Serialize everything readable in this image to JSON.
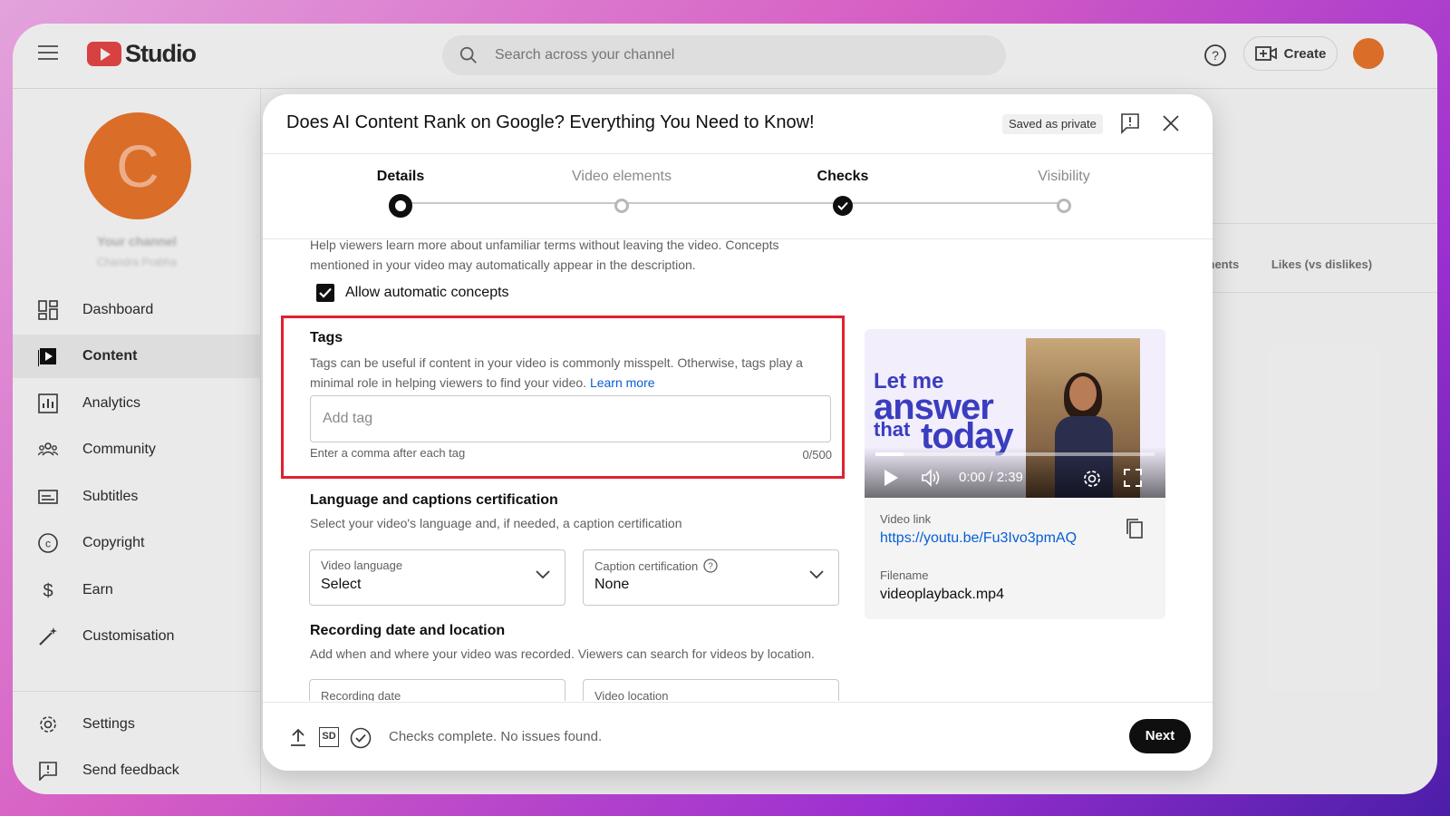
{
  "app": {
    "logo_text": "Studio",
    "search_placeholder": "Search across your channel",
    "create_label": "Create"
  },
  "sidebar": {
    "avatar_letter": "C",
    "channel_name": "Your channel",
    "channel_handle": "Chandra Prabha",
    "items": [
      {
        "label": "Dashboard",
        "icon": "dashboard-icon"
      },
      {
        "label": "Content",
        "icon": "content-icon"
      },
      {
        "label": "Analytics",
        "icon": "analytics-icon"
      },
      {
        "label": "Community",
        "icon": "community-icon"
      },
      {
        "label": "Subtitles",
        "icon": "subtitles-icon"
      },
      {
        "label": "Copyright",
        "icon": "copyright-icon"
      },
      {
        "label": "Earn",
        "icon": "earn-icon"
      },
      {
        "label": "Customisation",
        "icon": "customisation-icon"
      },
      {
        "label": "Settings",
        "icon": "settings-icon"
      },
      {
        "label": "Send feedback",
        "icon": "feedback-icon"
      }
    ],
    "active_item": "Content"
  },
  "background": {
    "col_comments": "Comments",
    "col_likes": "Likes (vs dislikes)"
  },
  "modal": {
    "title": "Does AI Content Rank on Google? Everything You Need to Know!",
    "saved_badge": "Saved as private",
    "steps": [
      {
        "label": "Details",
        "state": "current"
      },
      {
        "label": "Video elements",
        "state": "empty"
      },
      {
        "label": "Checks",
        "state": "done"
      },
      {
        "label": "Visibility",
        "state": "empty"
      }
    ],
    "concepts": {
      "description": "Help viewers learn more about unfamiliar terms without leaving the video. Concepts mentioned in your video may automatically appear in the description.",
      "checkbox_label": "Allow automatic concepts",
      "checked": true
    },
    "tags": {
      "title": "Tags",
      "description": "Tags can be useful if content in your video is commonly misspelt. Otherwise, tags play a minimal role in helping viewers to find your video.",
      "learn_more": "Learn more",
      "placeholder": "Add tag",
      "hint": "Enter a comma after each tag",
      "count": "0/500"
    },
    "language": {
      "title": "Language and captions certification",
      "description": "Select your video's language and, if needed, a caption certification",
      "video_language_label": "Video language",
      "video_language_value": "Select",
      "caption_label": "Caption certification",
      "caption_value": "None"
    },
    "recording": {
      "title": "Recording date and location",
      "description": "Add when and where your video was recorded. Viewers can search for videos by location.",
      "date_label": "Recording date",
      "location_label": "Video location"
    },
    "video": {
      "thumb_line1": "Let me",
      "thumb_line2": "answer",
      "thumb_line3": "that",
      "thumb_line4": "today",
      "time": "0:00 / 2:39",
      "progress": 0.1,
      "link_label": "Video link",
      "link": "https://youtu.be/Fu3Ivo3pmAQ",
      "filename_label": "Filename",
      "filename": "videoplayback.mp4"
    },
    "footer": {
      "sd_badge": "SD",
      "status": "Checks complete. No issues found.",
      "next_label": "Next"
    }
  }
}
